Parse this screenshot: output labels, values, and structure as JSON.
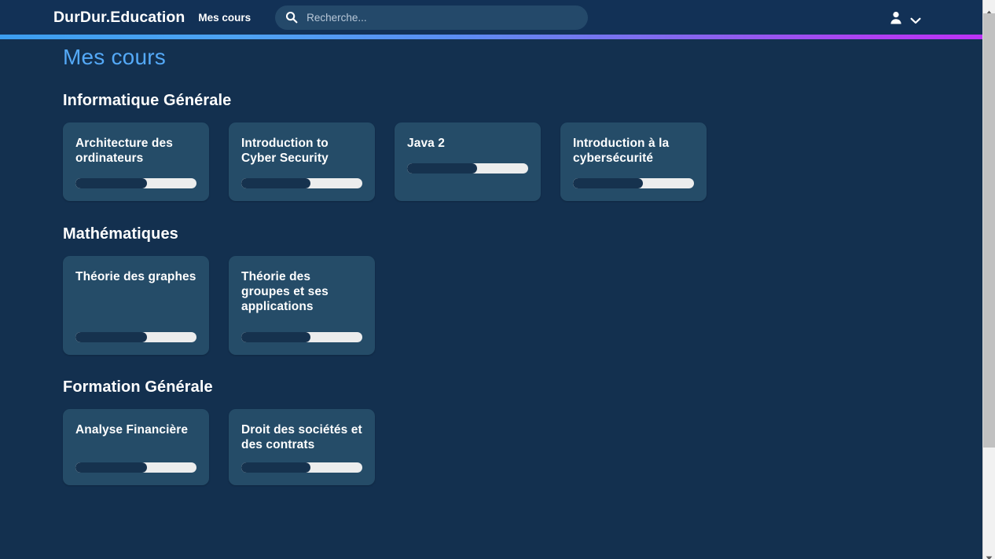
{
  "navbar": {
    "brand": "DurDur.Education",
    "nav_link": "Mes cours",
    "search": {
      "placeholder": "Recherche...",
      "value": "",
      "icon": "search-icon"
    },
    "account": {
      "user_icon": "user-icon",
      "chevron_icon": "chevron-down-icon"
    },
    "background_color": "#123156",
    "gradient_from": "#3c9ef0",
    "gradient_to": "#bb33f5"
  },
  "page": {
    "title": "Mes cours",
    "title_color": "#54a9f7",
    "background_color": "#13304f",
    "card_background_color": "#254c68"
  },
  "sections": [
    {
      "title": "Informatique Générale",
      "courses": [
        {
          "title": "Architecture des ordinateurs",
          "progress": 59
        },
        {
          "title": "Introduction to Cyber Security",
          "progress": 57
        },
        {
          "title": "Java 2",
          "progress": 58
        },
        {
          "title": "Introduction à la cybersécurité",
          "progress": 58
        }
      ]
    },
    {
      "title": "Mathématiques",
      "courses": [
        {
          "title": "Théorie des graphes",
          "progress": 59
        },
        {
          "title": "Théorie des groupes et ses applications",
          "progress": 57
        }
      ]
    },
    {
      "title": "Formation Générale",
      "courses": [
        {
          "title": "Analyse Financière",
          "progress": 59
        },
        {
          "title": "Droit des sociétés et des contrats",
          "progress": 57
        }
      ]
    }
  ],
  "scrollbar": {
    "up_arrow_icon": "scroll-up-arrow-icon",
    "down_arrow_icon": "scroll-down-arrow-icon",
    "thumb": "scrollbar-thumb"
  }
}
